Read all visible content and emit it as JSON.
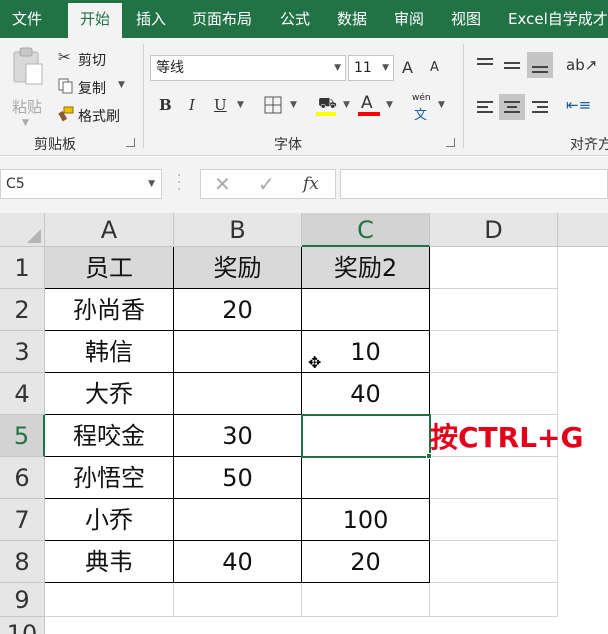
{
  "ribbon_tabs": [
    {
      "label": "文件"
    },
    {
      "label": "开始",
      "active": true
    },
    {
      "label": "插入"
    },
    {
      "label": "页面布局"
    },
    {
      "label": "公式"
    },
    {
      "label": "数据"
    },
    {
      "label": "审阅"
    },
    {
      "label": "视图"
    },
    {
      "label": "Excel自学成才"
    }
  ],
  "clipboard": {
    "paste_label": "粘贴",
    "cut_label": "剪切",
    "copy_label": "复制",
    "format_painter_label": "格式刷",
    "group_label": "剪贴板"
  },
  "font": {
    "font_name": "等线",
    "font_size": "11",
    "group_label": "字体",
    "phonetic_label": "wén",
    "bold": "B",
    "italic": "I",
    "underline": "U",
    "grow": "A",
    "shrink": "A"
  },
  "alignment": {
    "group_label": "对齐方"
  },
  "colors": {
    "accent": "#217346",
    "font_color_bar": "#ff0000",
    "fill_color_bar": "#ffff00",
    "callout": "#e3001b"
  },
  "formula_bar": {
    "name_box": "C5",
    "formula": "",
    "cancel_icon": "✕",
    "enter_icon": "✓",
    "fx_icon": "fx"
  },
  "sheet": {
    "columns": [
      "A",
      "B",
      "C",
      "D"
    ],
    "rows": [
      "1",
      "2",
      "3",
      "4",
      "5",
      "6",
      "7",
      "8",
      "9",
      "10"
    ],
    "table": [
      [
        "员工",
        "奖励",
        "奖励2"
      ],
      [
        "孙尚香",
        "20",
        ""
      ],
      [
        "韩信",
        "",
        "10"
      ],
      [
        "大乔",
        "",
        "40"
      ],
      [
        "程咬金",
        "30",
        ""
      ],
      [
        "孙悟空",
        "50",
        ""
      ],
      [
        "小乔",
        "",
        "100"
      ],
      [
        "典韦",
        "40",
        "20"
      ]
    ],
    "active_cell": "C5",
    "annotation": "按CTRL+G"
  }
}
